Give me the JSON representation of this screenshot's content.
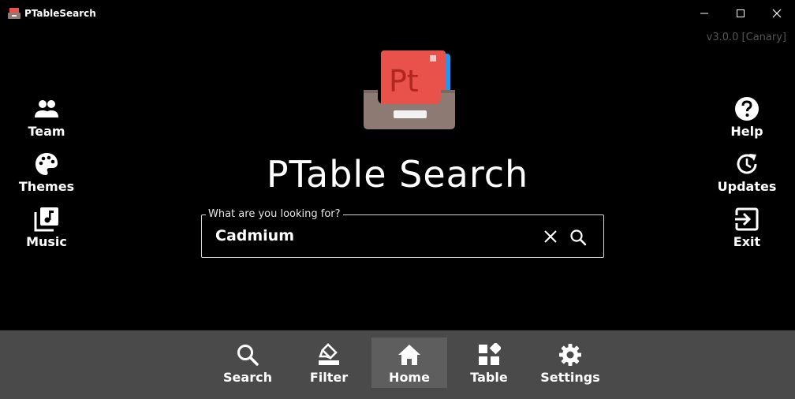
{
  "window": {
    "title": "PTableSearch",
    "version": "v3.0.0 [Canary]"
  },
  "logo": {
    "text": "Pt"
  },
  "heading": "PTable Search",
  "search": {
    "label": "What are you looking for?",
    "value": "Cadmium"
  },
  "left_buttons": [
    {
      "label": "Team",
      "icon": "team-icon"
    },
    {
      "label": "Themes",
      "icon": "palette-icon"
    },
    {
      "label": "Music",
      "icon": "music-icon"
    }
  ],
  "right_buttons": [
    {
      "label": "Help",
      "icon": "help-icon"
    },
    {
      "label": "Updates",
      "icon": "updates-icon"
    },
    {
      "label": "Exit",
      "icon": "exit-icon"
    }
  ],
  "bottom_nav": {
    "items": [
      {
        "label": "Search",
        "icon": "search-icon"
      },
      {
        "label": "Filter",
        "icon": "filter-icon"
      },
      {
        "label": "Home",
        "icon": "home-icon",
        "active": true
      },
      {
        "label": "Table",
        "icon": "table-icon"
      },
      {
        "label": "Settings",
        "icon": "gear-icon"
      }
    ]
  },
  "colors": {
    "background": "#000000",
    "bottom_bar": "#4a4a4a",
    "active_nav": "#5e5e5e",
    "logo_red": "#e8524a",
    "logo_tray": "#8d7b73"
  }
}
